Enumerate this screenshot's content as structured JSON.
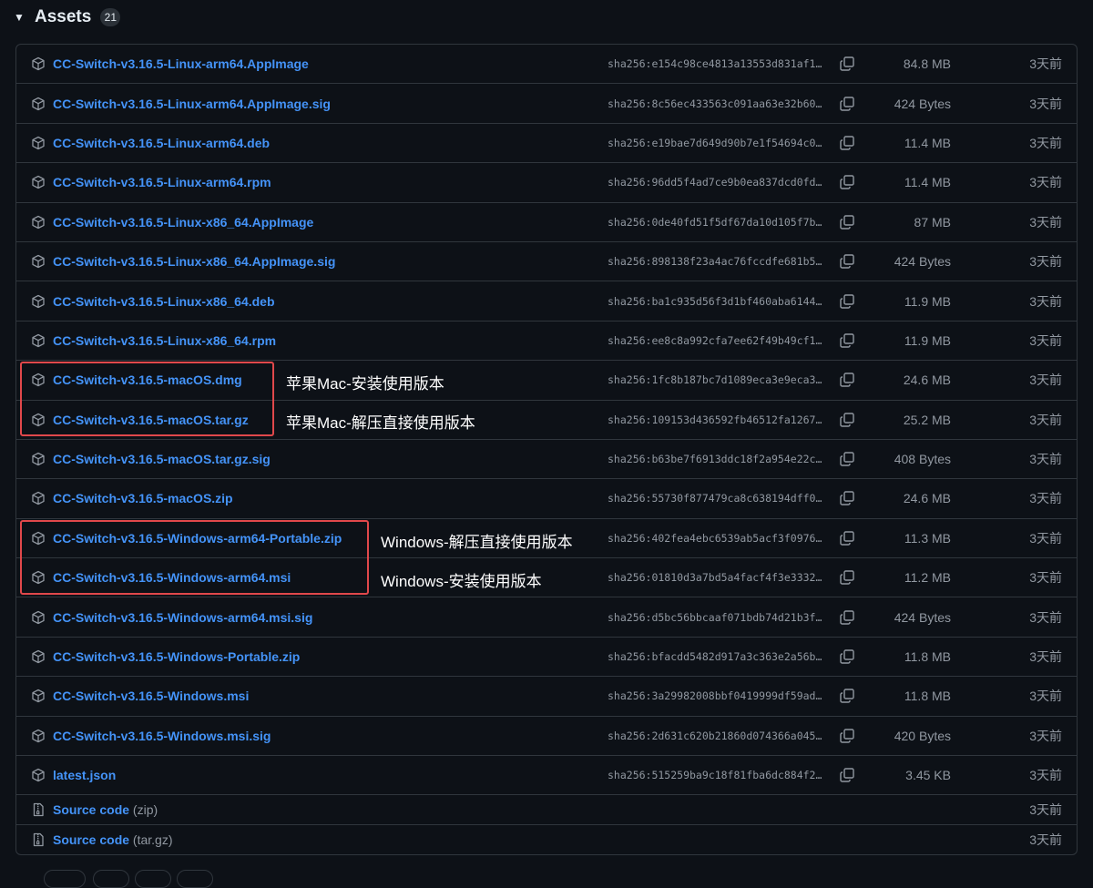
{
  "assets": {
    "caret": "▼",
    "title": "Assets",
    "count": "21",
    "rows": [
      {
        "name": "CC-Switch-v3.16.5-Linux-arm64.AppImage",
        "sha": "sha256:e154c98ce4813a13553d831af1…",
        "size": "84.8 MB",
        "date": "3天前"
      },
      {
        "name": "CC-Switch-v3.16.5-Linux-arm64.AppImage.sig",
        "sha": "sha256:8c56ec433563c091aa63e32b60…",
        "size": "424 Bytes",
        "date": "3天前"
      },
      {
        "name": "CC-Switch-v3.16.5-Linux-arm64.deb",
        "sha": "sha256:e19bae7d649d90b7e1f54694c0…",
        "size": "11.4 MB",
        "date": "3天前"
      },
      {
        "name": "CC-Switch-v3.16.5-Linux-arm64.rpm",
        "sha": "sha256:96dd5f4ad7ce9b0ea837dcd0fd…",
        "size": "11.4 MB",
        "date": "3天前"
      },
      {
        "name": "CC-Switch-v3.16.5-Linux-x86_64.AppImage",
        "sha": "sha256:0de40fd51f5df67da10d105f7b…",
        "size": "87 MB",
        "date": "3天前"
      },
      {
        "name": "CC-Switch-v3.16.5-Linux-x86_64.AppImage.sig",
        "sha": "sha256:898138f23a4ac76fccdfe681b5…",
        "size": "424 Bytes",
        "date": "3天前"
      },
      {
        "name": "CC-Switch-v3.16.5-Linux-x86_64.deb",
        "sha": "sha256:ba1c935d56f3d1bf460aba6144…",
        "size": "11.9 MB",
        "date": "3天前"
      },
      {
        "name": "CC-Switch-v3.16.5-Linux-x86_64.rpm",
        "sha": "sha256:ee8c8a992cfa7ee62f49b49cf1…",
        "size": "11.9 MB",
        "date": "3天前"
      },
      {
        "name": "CC-Switch-v3.16.5-macOS.dmg",
        "sha": "sha256:1fc8b187bc7d1089eca3e9eca3…",
        "size": "24.6 MB",
        "date": "3天前"
      },
      {
        "name": "CC-Switch-v3.16.5-macOS.tar.gz",
        "sha": "sha256:109153d436592fb46512fa1267…",
        "size": "25.2 MB",
        "date": "3天前"
      },
      {
        "name": "CC-Switch-v3.16.5-macOS.tar.gz.sig",
        "sha": "sha256:b63be7f6913ddc18f2a954e22c…",
        "size": "408 Bytes",
        "date": "3天前"
      },
      {
        "name": "CC-Switch-v3.16.5-macOS.zip",
        "sha": "sha256:55730f877479ca8c638194dff0…",
        "size": "24.6 MB",
        "date": "3天前"
      },
      {
        "name": "CC-Switch-v3.16.5-Windows-arm64-Portable.zip",
        "sha": "sha256:402fea4ebc6539ab5acf3f0976…",
        "size": "11.3 MB",
        "date": "3天前"
      },
      {
        "name": "CC-Switch-v3.16.5-Windows-arm64.msi",
        "sha": "sha256:01810d3a7bd5a4facf4f3e3332…",
        "size": "11.2 MB",
        "date": "3天前"
      },
      {
        "name": "CC-Switch-v3.16.5-Windows-arm64.msi.sig",
        "sha": "sha256:d5bc56bbcaaf071bdb74d21b3f…",
        "size": "424 Bytes",
        "date": "3天前"
      },
      {
        "name": "CC-Switch-v3.16.5-Windows-Portable.zip",
        "sha": "sha256:bfacdd5482d917a3c363e2a56b…",
        "size": "11.8 MB",
        "date": "3天前"
      },
      {
        "name": "CC-Switch-v3.16.5-Windows.msi",
        "sha": "sha256:3a29982008bbf0419999df59ad…",
        "size": "11.8 MB",
        "date": "3天前"
      },
      {
        "name": "CC-Switch-v3.16.5-Windows.msi.sig",
        "sha": "sha256:2d631c620b21860d074366a045…",
        "size": "420 Bytes",
        "date": "3天前"
      },
      {
        "name": "latest.json",
        "sha": "sha256:515259ba9c18f81fba6dc884f2…",
        "size": "3.45 KB",
        "date": "3天前"
      }
    ],
    "source_rows": [
      {
        "name": "Source code",
        "suffix": "(zip)",
        "date": "3天前"
      },
      {
        "name": "Source code",
        "suffix": "(tar.gz)",
        "date": "3天前"
      }
    ]
  },
  "annotations": {
    "mac_dmg": "苹果Mac-安装使用版本",
    "mac_targz": "苹果Mac-解压直接使用版本",
    "win_portable": "Windows-解压直接使用版本",
    "win_msi": "Windows-安装使用版本",
    "highlight_color": "#e0484b"
  },
  "icons": {
    "asset": "package-icon",
    "copy": "copy-icon",
    "source": "file-zip-icon"
  },
  "colors": {
    "background": "#0d1117",
    "link": "#4493f8",
    "muted": "#9198a1",
    "border": "#30363d"
  }
}
